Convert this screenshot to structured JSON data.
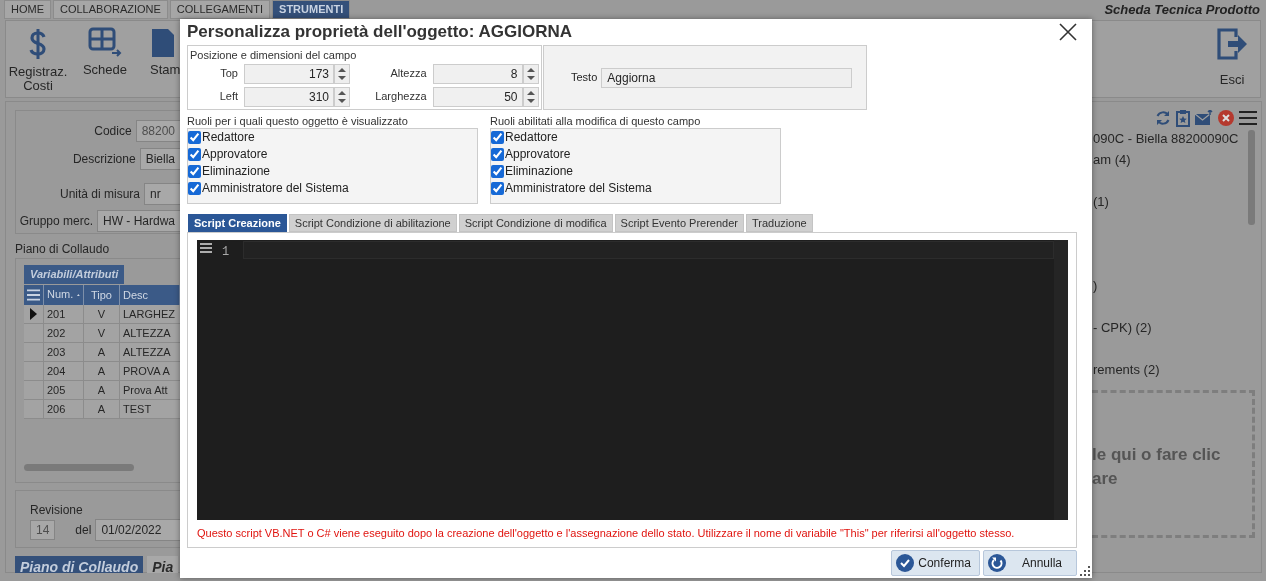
{
  "app": {
    "tabs": [
      {
        "label": "HOME",
        "selected": false
      },
      {
        "label": "COLLABORAZIONE",
        "selected": false
      },
      {
        "label": "COLLEGAMENTI",
        "selected": false
      },
      {
        "label": "STRUMENTI",
        "selected": true
      }
    ],
    "title": "Scheda Tecnica Prodotto"
  },
  "toolbar": {
    "buttons": [
      {
        "label": "Registraz.\nCosti",
        "kind": "dollar"
      },
      {
        "label": "Schede",
        "kind": "cards"
      },
      {
        "label": "Stam",
        "kind": "print"
      }
    ],
    "exit": {
      "label": "Esci",
      "kind": "exit"
    }
  },
  "form": {
    "fields": [
      {
        "label": "Codice",
        "value": "88200",
        "disabled": true
      },
      {
        "label": "Descrizione",
        "value": "Biella",
        "disabled": false
      },
      {
        "label": "Unità  di misura",
        "value": "nr",
        "disabled": false
      },
      {
        "label": "Gruppo merc.",
        "value": "HW - Hardwa",
        "disabled": false
      }
    ]
  },
  "test_plan": {
    "title": "Piano di Collaudo",
    "tab": "Variabili/Attributi",
    "columns": [
      "Num.",
      "Tipo",
      "Desc"
    ],
    "rows": [
      {
        "cells": [
          "201",
          "V",
          "LARGHEZ"
        ],
        "selected": true
      },
      {
        "cells": [
          "202",
          "V",
          "ALTEZZA"
        ],
        "selected": false
      },
      {
        "cells": [
          "203",
          "A",
          "ALTEZZA"
        ],
        "selected": false
      },
      {
        "cells": [
          "204",
          "A",
          "PROVA A"
        ],
        "selected": false
      },
      {
        "cells": [
          "205",
          "A",
          "Prova Att"
        ],
        "selected": false
      },
      {
        "cells": [
          "206",
          "A",
          "TEST"
        ],
        "selected": false
      }
    ]
  },
  "revision": {
    "label": "Revisione",
    "value": "14",
    "date_label": "del",
    "date": "01/02/2022"
  },
  "bottom_tabs": [
    {
      "label": "Piano di Collaudo",
      "selected": true
    },
    {
      "label": "Pia",
      "selected": false
    }
  ],
  "tree": {
    "items": [
      "090C - Biella 88200090C",
      "am (4)",
      "(1)",
      ")",
      "- CPK) (2)",
      "rements (2)"
    ]
  },
  "drop_zone": {
    "lines": [
      "le qui o fare clic",
      "are"
    ]
  },
  "dialog": {
    "title": "Personalizza proprietà dell'oggetto: AGGIORNA",
    "position": {
      "legend": "Posizione e dimensioni del campo",
      "fields": [
        {
          "label": "Top",
          "value": "173"
        },
        {
          "label": "Altezza",
          "value": "8"
        },
        {
          "label": "Left",
          "value": "310"
        },
        {
          "label": "Larghezza",
          "value": "50"
        }
      ]
    },
    "text_field": {
      "label": "Testo",
      "value": "Aggiorna"
    },
    "visible_roles": {
      "title": "Ruoli per i quali questo oggetto è visualizzato",
      "roles": [
        {
          "label": "Redattore",
          "checked": true
        },
        {
          "label": "Approvatore",
          "checked": true
        },
        {
          "label": "Eliminazione",
          "checked": true
        },
        {
          "label": "Amministratore del Sistema",
          "checked": true
        }
      ]
    },
    "edit_roles": {
      "title": "Ruoli abilitati alla modifica di questo campo",
      "roles": [
        {
          "label": "Redattore",
          "checked": true
        },
        {
          "label": "Approvatore",
          "checked": true
        },
        {
          "label": "Eliminazione",
          "checked": true
        },
        {
          "label": "Amministratore del Sistema",
          "checked": true
        }
      ]
    },
    "tabs": [
      {
        "label": "Script Creazione",
        "selected": true
      },
      {
        "label": "Script Condizione di abilitazione",
        "selected": false
      },
      {
        "label": "Script Condizione di modifica",
        "selected": false
      },
      {
        "label": "Script Evento Prerender",
        "selected": false
      },
      {
        "label": "Traduzione",
        "selected": false
      }
    ],
    "editor": {
      "line_numbers": [
        "1"
      ]
    },
    "note": "Questo script VB.NET o C# viene eseguito dopo la creazione dell'oggetto e l'assegnazione dello stato. Utilizzare il nome di variabile \"This\" per riferirsi all'oggetto stesso.",
    "buttons": [
      {
        "label": "Conferma",
        "kind": "confirm"
      },
      {
        "label": "Annulla",
        "kind": "cancel"
      }
    ]
  }
}
